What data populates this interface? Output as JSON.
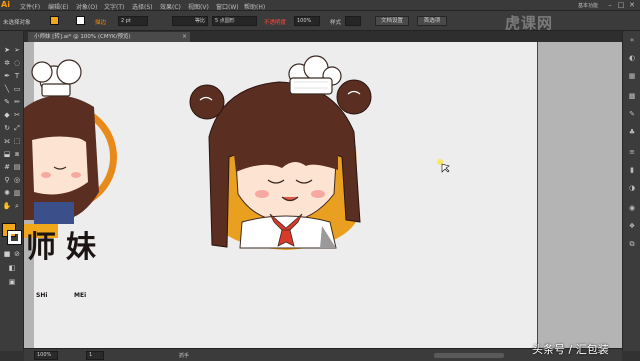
{
  "app": {
    "logo": "Ai",
    "workspace": "基本功能"
  },
  "menubar": {
    "items": [
      "文件(F)",
      "编辑(E)",
      "对象(O)",
      "文字(T)",
      "选择(S)",
      "效果(C)",
      "视图(V)",
      "窗口(W)",
      "帮助(H)"
    ]
  },
  "controlbar": {
    "selection": "未选择对象",
    "stroke_label": "描边",
    "stroke_weight": "2 pt",
    "profile": "等比",
    "brush": "5 点圆形",
    "opacity_label": "不透明度",
    "opacity": "100%",
    "style_label": "样式",
    "doc_setup": "文档设置",
    "preferences": "首选项"
  },
  "document": {
    "tab_title": "小师妹 [转].ai* @ 100% (CMYK/预览)"
  },
  "artwork": {
    "brand_char1": "师",
    "brand_char2": "妹",
    "pinyin1": "SHi",
    "pinyin2": "MEi"
  },
  "statusbar": {
    "zoom": "100%",
    "page": "1",
    "tool": "抓手"
  },
  "watermark": {
    "brand": "虎课网",
    "caption": "头条号 / 汇包装"
  },
  "colors": {
    "accent_orange": "#f0a81a",
    "artboard_edge": "#e0001b",
    "hair": "#5b2e22",
    "skin": "#fde3d2"
  }
}
